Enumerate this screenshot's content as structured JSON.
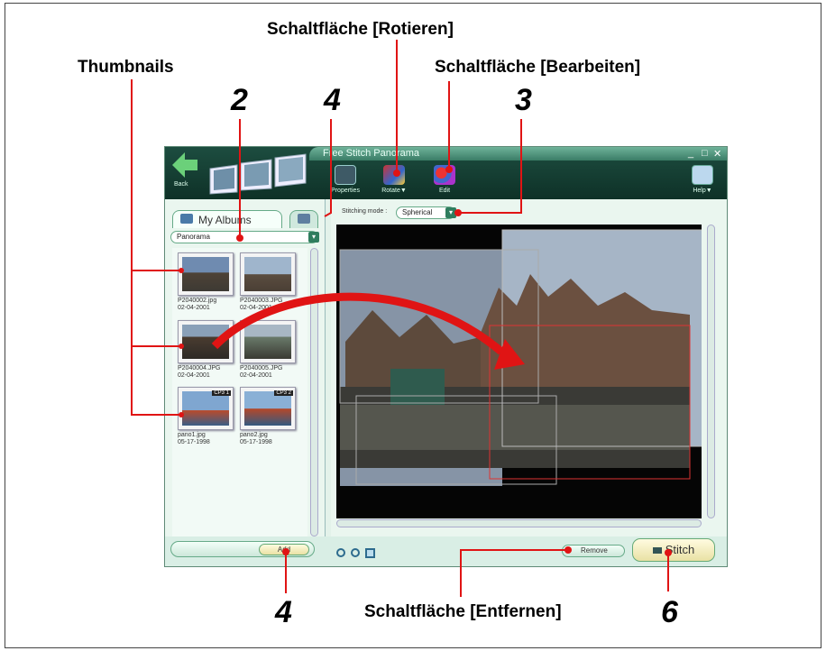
{
  "callouts": {
    "rotate_button": "Schaltfläche [Rotieren]",
    "edit_button": "Schaltfläche [Bearbeiten]",
    "thumbnails": "Thumbnails",
    "remove_button": "Schaltfläche [Entfernen]",
    "step_2": "2",
    "step_4_top": "4",
    "step_3": "3",
    "step_4_bottom": "4",
    "step_6": "6"
  },
  "window": {
    "title": "Free Stitch Panorama",
    "controls": [
      "_",
      "□",
      "✕"
    ],
    "back_label": "Back",
    "toolbar": {
      "properties": "Properties",
      "rotate": "Rotate▼",
      "edit": "Edit",
      "help": "Help▼"
    },
    "stitching_mode_label": "Stitching mode :",
    "stitching_mode_value": "Spherical"
  },
  "left_panel": {
    "tab_label": "My Albums",
    "album_select": "Panorama",
    "thumbnails": [
      {
        "name": "P2040002.jpg",
        "date": "02-04-2001",
        "badge": ""
      },
      {
        "name": "P2040003.JPG",
        "date": "02-04-2001",
        "badge": ""
      },
      {
        "name": "P2040004.JPG",
        "date": "02-04-2001",
        "badge": ""
      },
      {
        "name": "P2040005.JPG",
        "date": "02-04-2001",
        "badge": ""
      },
      {
        "name": "pano1.jpg",
        "date": "05-17-1998",
        "badge": "CP3 1"
      },
      {
        "name": "pano2.jpg",
        "date": "05-17-1998",
        "badge": "CP3 2"
      }
    ],
    "add_button": "Add"
  },
  "bottom_bar": {
    "remove_button": "Remove",
    "stitch_button": "Stitch"
  },
  "colors": {
    "callout_red": "#e01414",
    "window_green": "#1d4d40",
    "panel_bg": "#eaf6ef"
  }
}
